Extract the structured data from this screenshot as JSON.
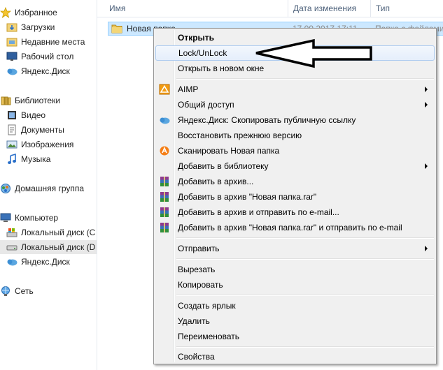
{
  "nav": {
    "favorites": {
      "title": "Избранное",
      "items": [
        "Загрузки",
        "Недавние места",
        "Рабочий стол",
        "Яндекс.Диск"
      ]
    },
    "libraries": {
      "title": "Библиотеки",
      "items": [
        "Видео",
        "Документы",
        "Изображения",
        "Музыка"
      ]
    },
    "homegroup": {
      "title": "Домашняя группа"
    },
    "computer": {
      "title": "Компьютер",
      "items": [
        "Локальный диск (C",
        "Локальный диск (D",
        "Яндекс.Диск"
      ]
    },
    "network": {
      "title": "Сеть"
    }
  },
  "columns": {
    "name": "Имя",
    "date": "Дата изменения",
    "type": "Тип"
  },
  "file": {
    "name": "Новая папка",
    "date": "17.09.2017 17:11",
    "type": "Папка с файлами"
  },
  "menu": {
    "items": [
      {
        "label": "Открыть",
        "bold": true
      },
      {
        "label": "Lock/UnLock"
      },
      {
        "label": "Открыть в новом окне"
      },
      {
        "label": "AIMP",
        "icon": "aimp-icon",
        "submenu": true
      },
      {
        "label": "Общий доступ",
        "submenu": true
      },
      {
        "label": "Яндекс.Диск: Скопировать публичную ссылку",
        "icon": "yandex-disk-icon"
      },
      {
        "label": "Восстановить прежнюю версию"
      },
      {
        "label": "Сканировать Новая папка",
        "icon": "avast-icon"
      },
      {
        "label": "Добавить в библиотеку",
        "submenu": true
      },
      {
        "label": "Добавить в архив...",
        "icon": "winrar-icon"
      },
      {
        "label": "Добавить в архив \"Новая папка.rar\"",
        "icon": "winrar-icon"
      },
      {
        "label": "Добавить в архив и отправить по e-mail...",
        "icon": "winrar-icon"
      },
      {
        "label": "Добавить в архив \"Новая папка.rar\" и отправить по e-mail",
        "icon": "winrar-icon"
      },
      {
        "label": "Отправить",
        "submenu": true
      },
      {
        "label": "Вырезать"
      },
      {
        "label": "Копировать"
      },
      {
        "label": "Создать ярлык"
      },
      {
        "label": "Удалить"
      },
      {
        "label": "Переименовать"
      },
      {
        "label": "Свойства"
      }
    ]
  },
  "colors": {
    "selection_bg": "#cce8ff",
    "selection_border": "#99d1ff",
    "menu_bg": "#f0f0f0",
    "header_text": "#4c607a"
  }
}
